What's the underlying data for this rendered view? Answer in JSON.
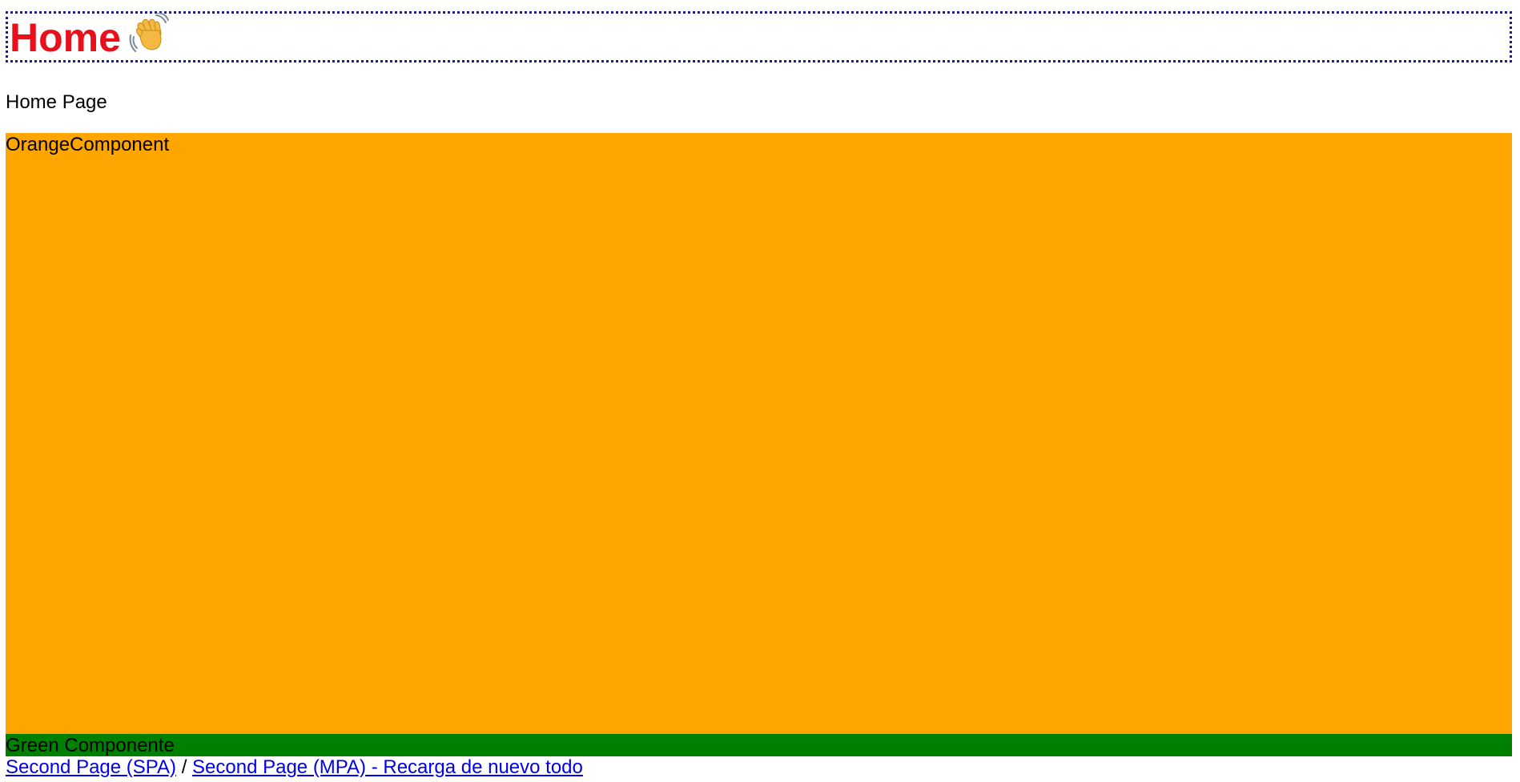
{
  "header": {
    "title": "Home",
    "title_color": "#e8101b",
    "icon": "waving-hand-icon",
    "border_color": "#1a1aa6"
  },
  "main": {
    "subtitle": "Home Page"
  },
  "orange_component": {
    "label": "OrangeComponent",
    "color": "#ffa500"
  },
  "green_component": {
    "label": "Green Componente",
    "color": "#008000"
  },
  "nav": {
    "spa_link": "Second Page (SPA)",
    "separator": "/",
    "mpa_link": "Second Page (MPA) - Recarga de nuevo todo",
    "link_color": "#0000ee"
  }
}
